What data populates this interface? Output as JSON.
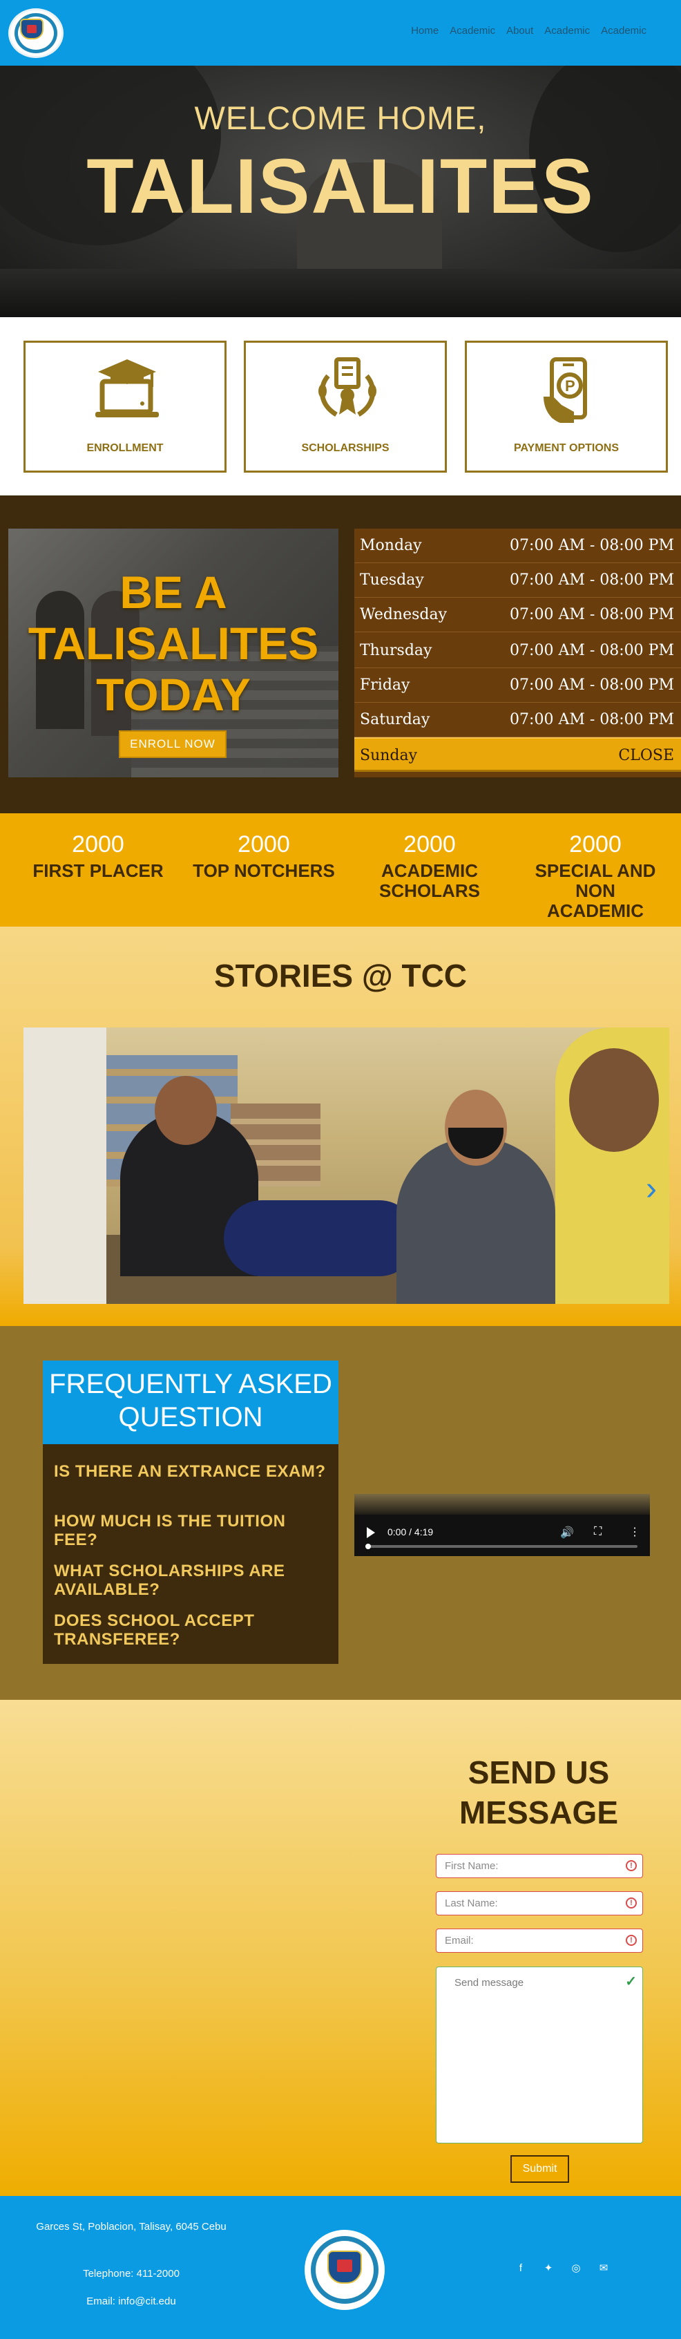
{
  "nav": {
    "links": [
      "Home",
      "Academic",
      "About",
      "Academic",
      "Academic"
    ]
  },
  "hero": {
    "subtitle": "WELCOME HOME,",
    "title": "TALISALITES"
  },
  "services": [
    {
      "label": "ENROLLMENT",
      "icon": "graduation-laptop-icon"
    },
    {
      "label": "SCHOLARSHIPS",
      "icon": "certificate-laurel-icon"
    },
    {
      "label": "PAYMENT OPTIONS",
      "icon": "mobile-payment-icon"
    }
  ],
  "promo": {
    "line1": "BE A",
    "line2": "TALISALITES",
    "line3": "TODAY",
    "button": "ENROLL NOW"
  },
  "schedule": [
    {
      "day": "Monday",
      "time": "07:00 AM - 08:00 PM"
    },
    {
      "day": "Tuesday",
      "time": "07:00 AM - 08:00 PM"
    },
    {
      "day": "Wednesday",
      "time": "07:00 AM - 08:00 PM"
    },
    {
      "day": "Thursday",
      "time": "07:00 AM - 08:00 PM"
    },
    {
      "day": "Friday",
      "time": "07:00 AM - 08:00 PM"
    },
    {
      "day": "Saturday",
      "time": "07:00 AM - 08:00 PM"
    },
    {
      "day": "Sunday",
      "time": "CLOSE"
    }
  ],
  "stats": [
    {
      "num": "2000",
      "label": "FIRST PLACER"
    },
    {
      "num": "2000",
      "label": "TOP NOTCHERS"
    },
    {
      "num": "2000",
      "label": "ACADEMIC SCHOLARS"
    },
    {
      "num": "2000",
      "label": "SPECIAL AND NON ACADEMIC"
    }
  ],
  "stories": {
    "title": "STORIES @ TCC",
    "next_arrow": "›"
  },
  "faq": {
    "title": "FREQUENTLY ASKED QUESTION",
    "questions": [
      "IS THERE AN EXTRANCE EXAM?",
      "HOW MUCH IS THE TUITION FEE?",
      "WHAT SCHOLARSHIPS ARE AVAILABLE?",
      "DOES SCHOOL ACCEPT TRANSFEREE?"
    ]
  },
  "video": {
    "time": "0:00 / 4:19"
  },
  "contact": {
    "title": "SEND US MESSAGE",
    "first_name": "First Name:",
    "last_name": "Last Name:",
    "email": "Email:",
    "message": "Send message",
    "submit": "Submit"
  },
  "footer": {
    "address": "Garces St, Poblacion, Talisay, 6045 Cebu",
    "telephone": "Telephone: 411-2000",
    "email": "Email: info@cit.edu",
    "socials": [
      "facebook-icon",
      "twitter-icon",
      "instagram-icon",
      "mail-icon"
    ]
  },
  "colors": {
    "brand_blue": "#0b9be3",
    "brand_gold": "#f0ab00",
    "brand_brown": "#3e2b0e"
  }
}
